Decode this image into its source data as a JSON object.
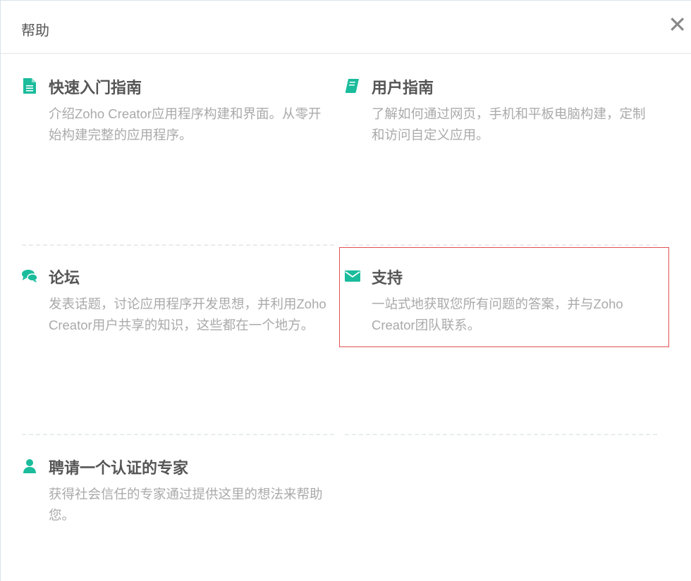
{
  "header": {
    "title": "帮助",
    "close_icon": "close-icon"
  },
  "accent": "#1abc9c",
  "cards": [
    {
      "title": "快速入门指南",
      "desc": "介绍Zoho Creator应用程序构建和界面。从零开始构建完整的应用程序。",
      "icon": "document-icon"
    },
    {
      "title": "用户指南",
      "desc": "了解如何通过网页，手机和平板电脑构建，定制和访问自定义应用。",
      "icon": "book-icon"
    },
    {
      "title": "论坛",
      "desc": "发表话题，讨论应用程序开发思想，并利用Zoho Creator用户共享的知识，这些都在一个地方。",
      "icon": "comments-icon"
    },
    {
      "title": "支持",
      "desc": "一站式地获取您所有问题的答案，并与Zoho Creator团队联系。",
      "icon": "envelope-icon"
    },
    {
      "title": "聘请一个认证的专家",
      "desc": "获得社会信任的专家通过提供这里的想法来帮助您。",
      "icon": "user-icon"
    }
  ]
}
